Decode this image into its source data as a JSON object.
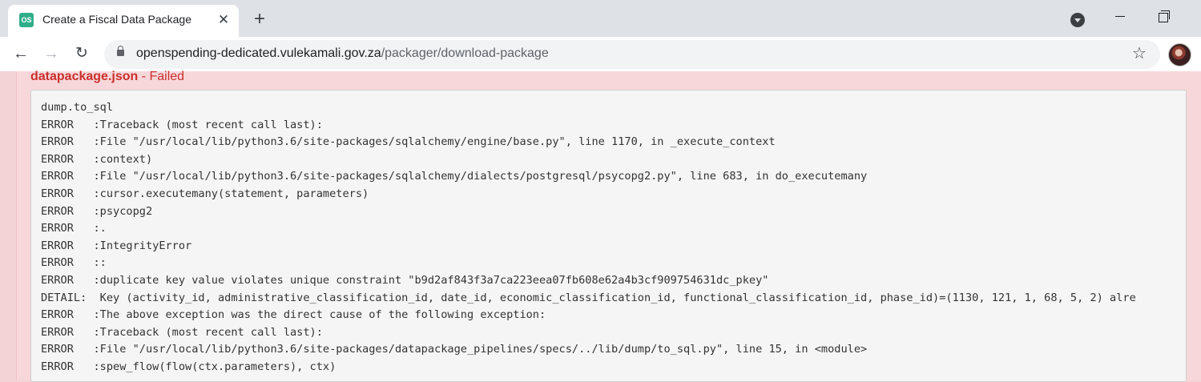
{
  "browser": {
    "tab": {
      "favicon_text": "OS",
      "title": "Create a Fiscal Data Package",
      "close_glyph": "✕"
    },
    "new_tab_glyph": "+",
    "url_host": "openspending-dedicated.vulekamali.gov.za",
    "url_path": "/packager/download-package",
    "icons": [
      "back-icon",
      "forward-icon",
      "reload-icon",
      "lock-icon",
      "star-icon",
      "tab-search-icon",
      "minimize-icon",
      "restore-icon"
    ]
  },
  "panel": {
    "filename": "datapackage.json",
    "status": " - Failed",
    "log_lines": [
      "dump.to_sql",
      "ERROR   :Traceback (most recent call last):",
      "ERROR   :File \"/usr/local/lib/python3.6/site-packages/sqlalchemy/engine/base.py\", line 1170, in _execute_context",
      "ERROR   :context)",
      "ERROR   :File \"/usr/local/lib/python3.6/site-packages/sqlalchemy/dialects/postgresql/psycopg2.py\", line 683, in do_executemany",
      "ERROR   :cursor.executemany(statement, parameters)",
      "ERROR   :psycopg2",
      "ERROR   :.",
      "ERROR   :IntegrityError",
      "ERROR   ::",
      "ERROR   :duplicate key value violates unique constraint \"b9d2af843f3a7ca223eea07fb608e62a4b3cf909754631dc_pkey\"",
      "DETAIL:  Key (activity_id, administrative_classification_id, date_id, economic_classification_id, functional_classification_id, phase_id)=(1130, 121, 1, 68, 5, 2) alre",
      "ERROR   :The above exception was the direct cause of the following exception:",
      "ERROR   :Traceback (most recent call last):",
      "ERROR   :File \"/usr/local/lib/python3.6/site-packages/datapackage_pipelines/specs/../lib/dump/to_sql.py\", line 15, in <module>",
      "ERROR   :spew_flow(flow(ctx.parameters), ctx)"
    ]
  },
  "colors": {
    "page_background": "#f3d3d6",
    "alert_text": "#c9302c",
    "code_background": "#f5f5f5"
  }
}
